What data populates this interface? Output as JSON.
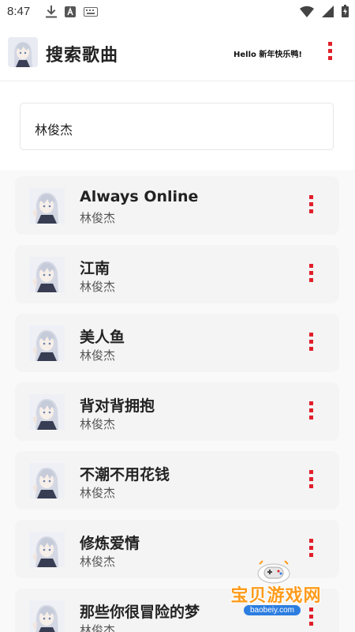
{
  "status_bar": {
    "time": "8:47",
    "left_icons": [
      "download-icon",
      "a-letter-icon",
      "keyboard-icon"
    ],
    "right_icons": [
      "wifi-icon",
      "signal-icon",
      "battery-icon"
    ]
  },
  "header": {
    "title": "搜索歌曲",
    "greeting": "Hello 新年快乐鸭!",
    "menu_icon": "more-vertical-icon"
  },
  "search": {
    "value": "林俊杰"
  },
  "songs": [
    {
      "title": "Always Online",
      "artist": "林俊杰"
    },
    {
      "title": "江南",
      "artist": "林俊杰"
    },
    {
      "title": "美人鱼",
      "artist": "林俊杰"
    },
    {
      "title": "背对背拥抱",
      "artist": "林俊杰"
    },
    {
      "title": "不潮不用花钱",
      "artist": "林俊杰"
    },
    {
      "title": "修炼爱情",
      "artist": "林俊杰"
    },
    {
      "title": "那些你很冒险的梦",
      "artist": "林俊杰"
    }
  ],
  "watermark": {
    "text": "宝贝游戏网",
    "url": "baobeiy.com"
  },
  "colors": {
    "accent": "#e0202a",
    "card_bg": "#f4f4f4",
    "list_bg": "#f9f9f9",
    "watermark": "#ff9b1a"
  }
}
